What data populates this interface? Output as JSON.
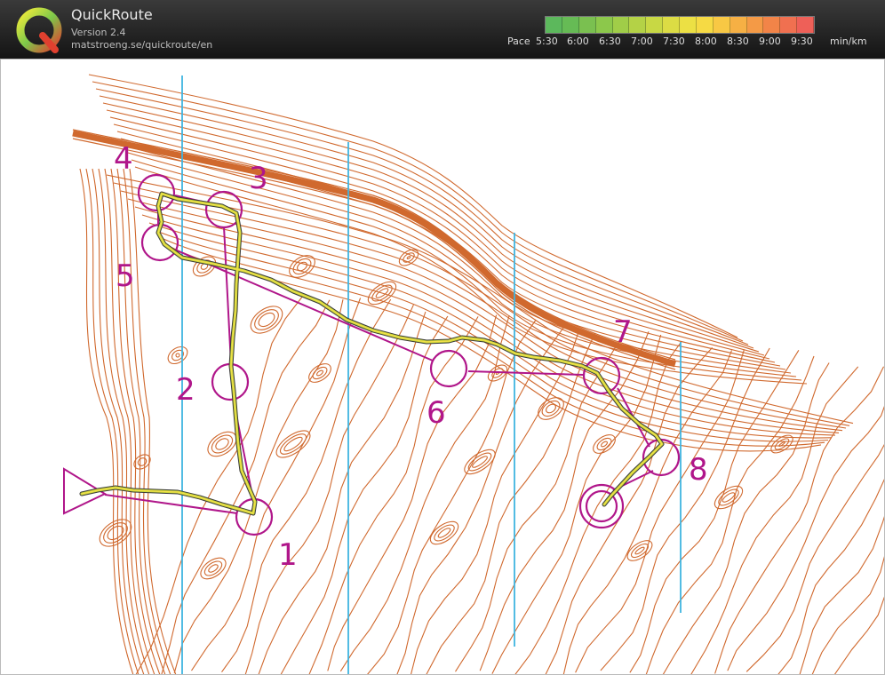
{
  "app": {
    "title": "QuickRoute",
    "version": "Version 2.4",
    "url": "matstroeng.se/quickroute/en"
  },
  "pace_scale": {
    "label": "Pace",
    "ticks": [
      "5:30",
      "6:00",
      "6:30",
      "7:00",
      "7:30",
      "8:00",
      "8:30",
      "9:00",
      "9:30"
    ],
    "unit": "min/km",
    "colors": [
      "#5cb85c",
      "#66bb55",
      "#7ac050",
      "#8cc84b",
      "#a0cd48",
      "#b4d246",
      "#c8d844",
      "#dcdc44",
      "#ece044",
      "#f6da44",
      "#f8c844",
      "#f6b044",
      "#f49a46",
      "#f28448",
      "#f07050",
      "#ee6058"
    ]
  },
  "map": {
    "contour_color": "#d0692e",
    "magnetic_north_line_color": "#3fb4e0",
    "course_color": "#b0168a",
    "controls": [
      {
        "number": "1"
      },
      {
        "number": "2"
      },
      {
        "number": "3"
      },
      {
        "number": "4"
      },
      {
        "number": "5"
      },
      {
        "number": "6"
      },
      {
        "number": "7"
      },
      {
        "number": "8"
      }
    ]
  }
}
